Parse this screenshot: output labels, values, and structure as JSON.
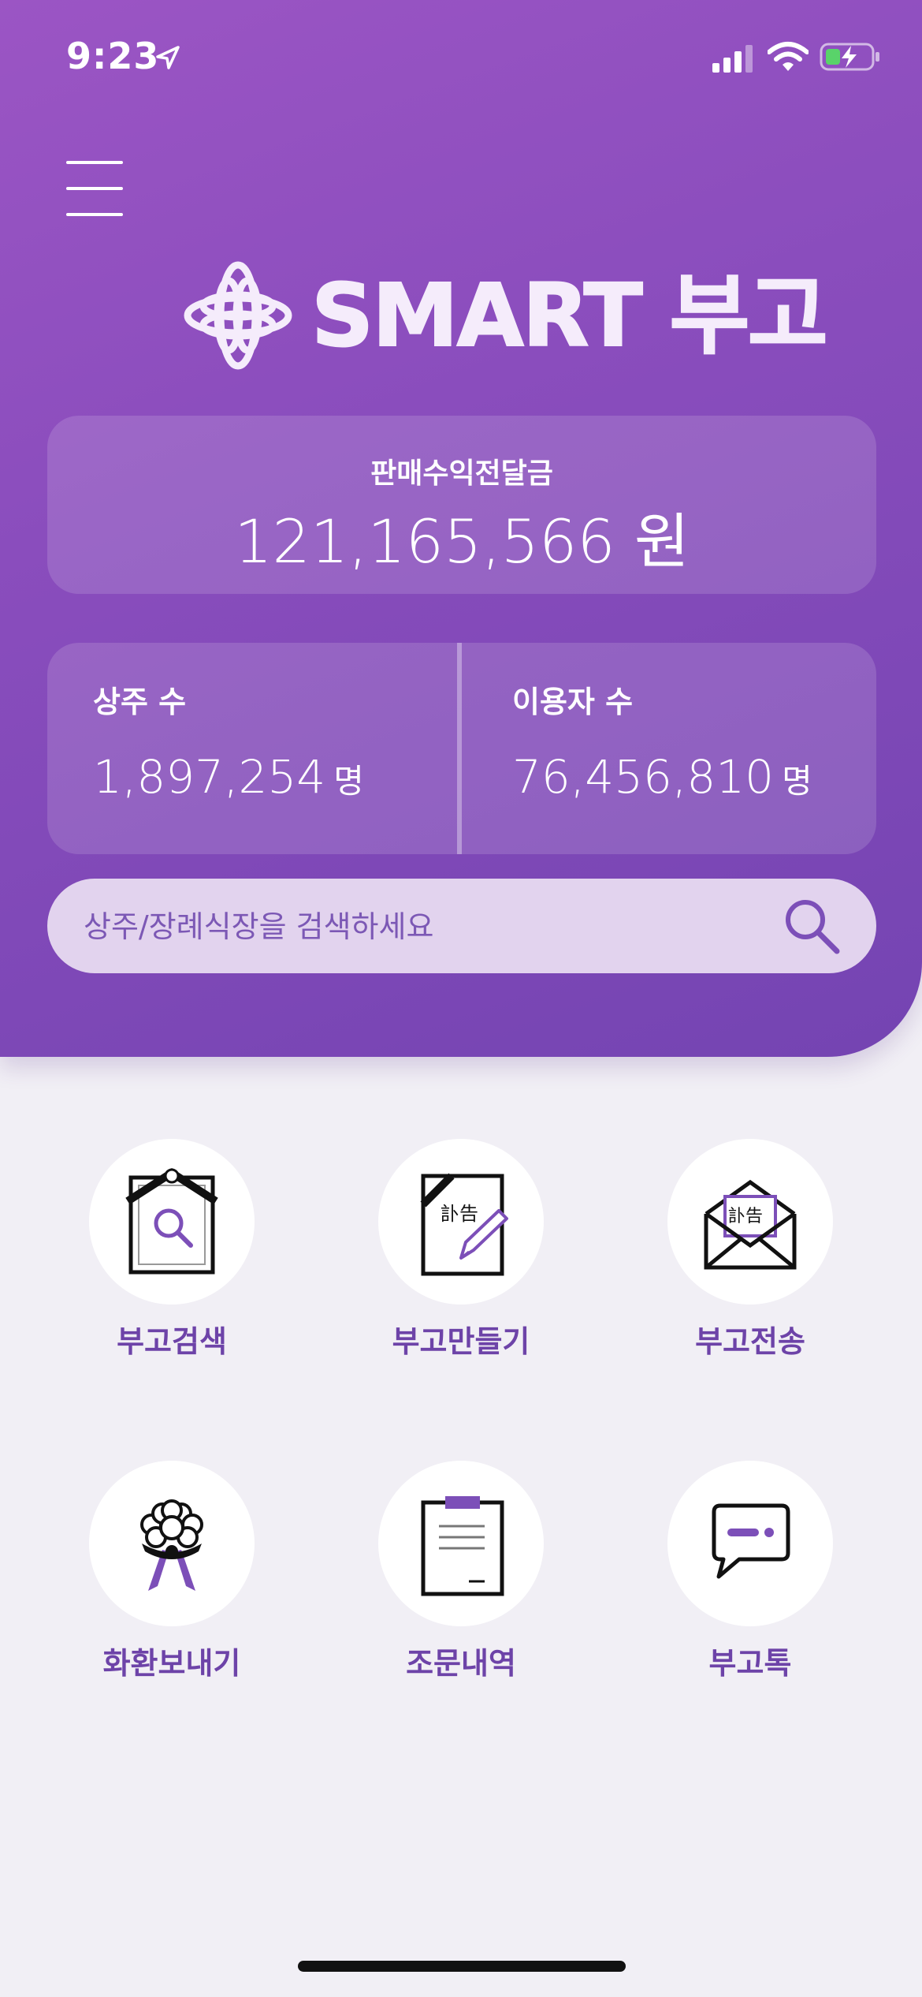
{
  "status_bar": {
    "time": "9:23"
  },
  "header": {
    "brand": "SMART 부고"
  },
  "revenue": {
    "label": "판매수익전달금",
    "value": "121,165,566 원"
  },
  "stats": {
    "mourners": {
      "label": "상주 수",
      "value": "1,897,254",
      "unit": "명"
    },
    "users": {
      "label": "이용자 수",
      "value": "76,456,810",
      "unit": "명"
    }
  },
  "search": {
    "placeholder": "상주/장례식장을 검색하세요"
  },
  "menu": {
    "items": [
      {
        "label": "부고검색",
        "icon": "obituary-search-icon"
      },
      {
        "label": "부고만들기",
        "icon": "obituary-create-icon"
      },
      {
        "label": "부고전송",
        "icon": "obituary-send-icon"
      },
      {
        "label": "화환보내기",
        "icon": "wreath-icon"
      },
      {
        "label": "조문내역",
        "icon": "condolence-history-icon"
      },
      {
        "label": "부고톡",
        "icon": "chat-icon"
      }
    ]
  },
  "icon_text": "訃告",
  "colors": {
    "accent": "#8a4dbd",
    "label": "#6d43a8",
    "search_bg": "#e2d3ee"
  }
}
